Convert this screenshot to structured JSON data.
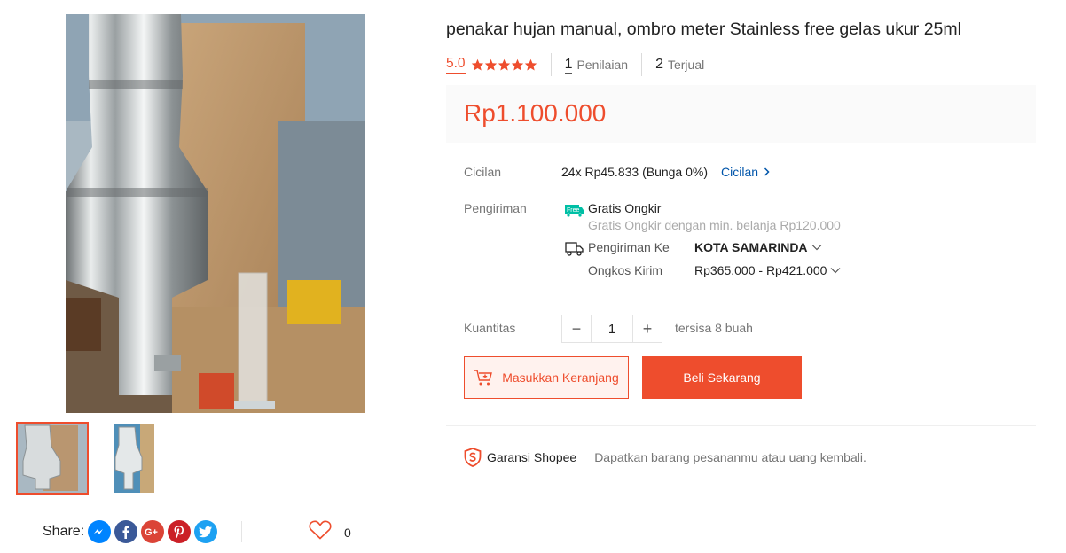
{
  "product": {
    "title": "penakar hujan manual, ombro meter Stainless free gelas ukur 25ml",
    "rating": "5.0",
    "rating_stars": 5,
    "rating_count": "1",
    "rating_count_label": "Penilaian",
    "sold_count": "2",
    "sold_label": "Terjual",
    "price": "Rp1.100.000"
  },
  "cicilan": {
    "label": "Cicilan",
    "value": "24x Rp45.833 (Bunga 0%)",
    "link": "Cicilan"
  },
  "shipping": {
    "label": "Pengiriman",
    "free_badge": "Free",
    "free_title": "Gratis Ongkir",
    "free_desc": "Gratis Ongkir dengan min. belanja Rp120.000",
    "to_label": "Pengiriman Ke",
    "to_value": "KOTA SAMARINDA",
    "cost_label": "Ongkos Kirim",
    "cost_value": "Rp365.000 - Rp421.000"
  },
  "quantity": {
    "label": "Kuantitas",
    "value": "1",
    "minus": "−",
    "plus": "+",
    "stock": "tersisa 8 buah"
  },
  "actions": {
    "add_to_cart": "Masukkan Keranjang",
    "buy_now": "Beli Sekarang"
  },
  "guarantee": {
    "title": "Garansi Shopee",
    "desc": "Dapatkan barang pesananmu atau uang kembali."
  },
  "share": {
    "label": "Share:",
    "networks": [
      "messenger-icon",
      "facebook-icon",
      "google-plus-icon",
      "pinterest-icon",
      "twitter-icon"
    ]
  },
  "like": {
    "count": "0"
  },
  "colors": {
    "accent": "#ee4d2d",
    "link": "#0055aa",
    "messenger": "#0084ff",
    "facebook": "#3b5998",
    "google_plus": "#db4437",
    "pinterest": "#cb2027",
    "twitter": "#1da1f2",
    "free_badge": "#00bfa5"
  }
}
